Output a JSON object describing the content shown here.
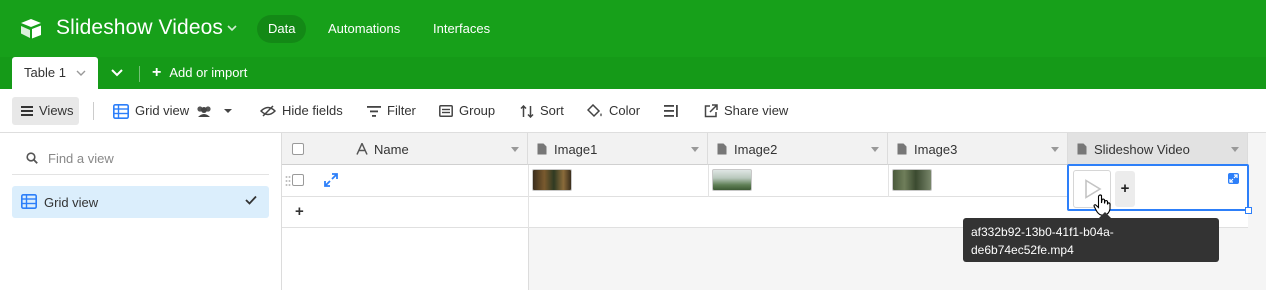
{
  "header": {
    "base_title": "Slideshow Videos",
    "nav": [
      "Data",
      "Automations",
      "Interfaces"
    ],
    "brand_color": "#17a01a"
  },
  "tabs": {
    "table_name": "Table 1",
    "add_import": "Add or import"
  },
  "toolbar": {
    "views": "Views",
    "grid_view": "Grid view",
    "hide_fields": "Hide fields",
    "filter": "Filter",
    "group": "Group",
    "sort": "Sort",
    "color": "Color",
    "share_view": "Share view"
  },
  "sidebar": {
    "search_placeholder": "Find a view",
    "views": [
      {
        "label": "Grid view",
        "selected": true
      }
    ]
  },
  "grid": {
    "columns": [
      {
        "label": "Name",
        "icon": "text-icon"
      },
      {
        "label": "Image1",
        "icon": "attachment-icon"
      },
      {
        "label": "Image2",
        "icon": "attachment-icon"
      },
      {
        "label": "Image3",
        "icon": "attachment-icon"
      },
      {
        "label": "Slideshow Video",
        "icon": "attachment-icon"
      }
    ],
    "add_row": "+"
  },
  "tooltip": {
    "text": "af332b92-13b0-41f1-b04a-de6b74ec52fe.mp4"
  }
}
